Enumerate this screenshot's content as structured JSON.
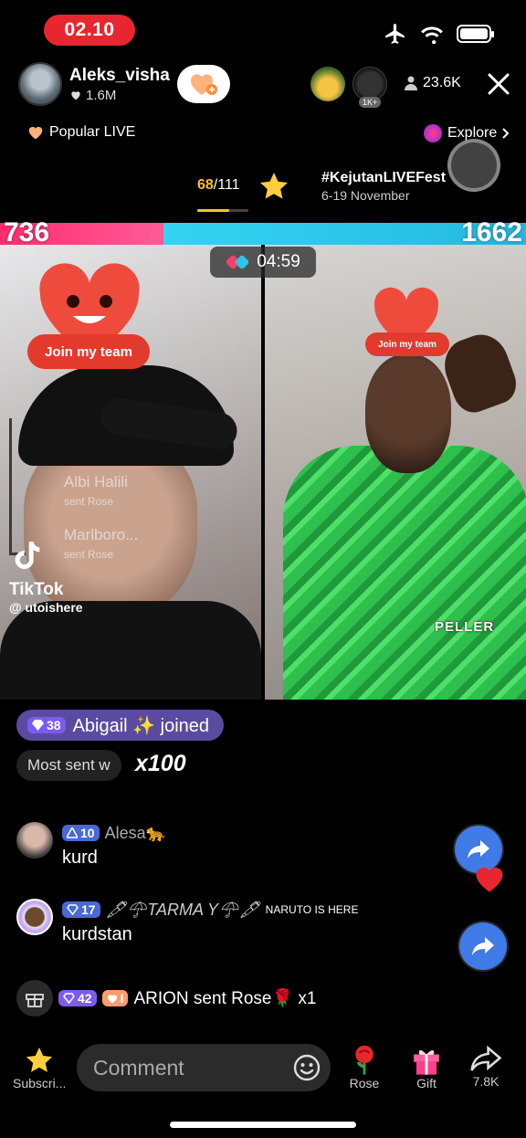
{
  "status": {
    "time": "02.10"
  },
  "host": {
    "name": "Aleks_visha",
    "likes": "1.6M"
  },
  "viewers": {
    "count": "23.6K",
    "badge": "1K+"
  },
  "nav": {
    "popular_label": "Popular LIVE",
    "explore_label": "Explore"
  },
  "rank": {
    "current": "68",
    "total": "/111",
    "progress_pct": 62
  },
  "event": {
    "title": "#KejutanLIVEFest",
    "dates": "6-19 November"
  },
  "battle": {
    "score_left": "736",
    "score_right": "1662",
    "left_fraction": 0.31,
    "timer": "04:59"
  },
  "left_pane": {
    "team_label": "Join my team",
    "gift_user1": "Albi Halili",
    "gift_action1": "sent Rose",
    "gift_user2": "Marlboro...",
    "gift_action2": "sent Rose",
    "watermark_brand": "TikTok",
    "watermark_handle": "@ utoishere"
  },
  "right_pane": {
    "team_label": "Join my team",
    "tag": "PELLER"
  },
  "chat": {
    "joined": {
      "level": "38",
      "text": "Abigail ✨ joined"
    },
    "most_sent": {
      "text": "Most sent w",
      "multiplier": "x100"
    },
    "messages": [
      {
        "level": "10",
        "username": "Alesa🐆",
        "text": "kurd"
      },
      {
        "level": "17",
        "username": "🖋☂TARMA Y☂🖋",
        "extra": "NARUTO IS HERE",
        "text": "kurdstan"
      }
    ],
    "gift": {
      "level": "42",
      "fan_level": "I",
      "text": "ARION sent Rose🌹 x1"
    }
  },
  "bottom": {
    "subscribe_label": "Subscri...",
    "comment_placeholder": "Comment",
    "rose_label": "Rose",
    "gift_label": "Gift",
    "share_count": "7.8K"
  }
}
